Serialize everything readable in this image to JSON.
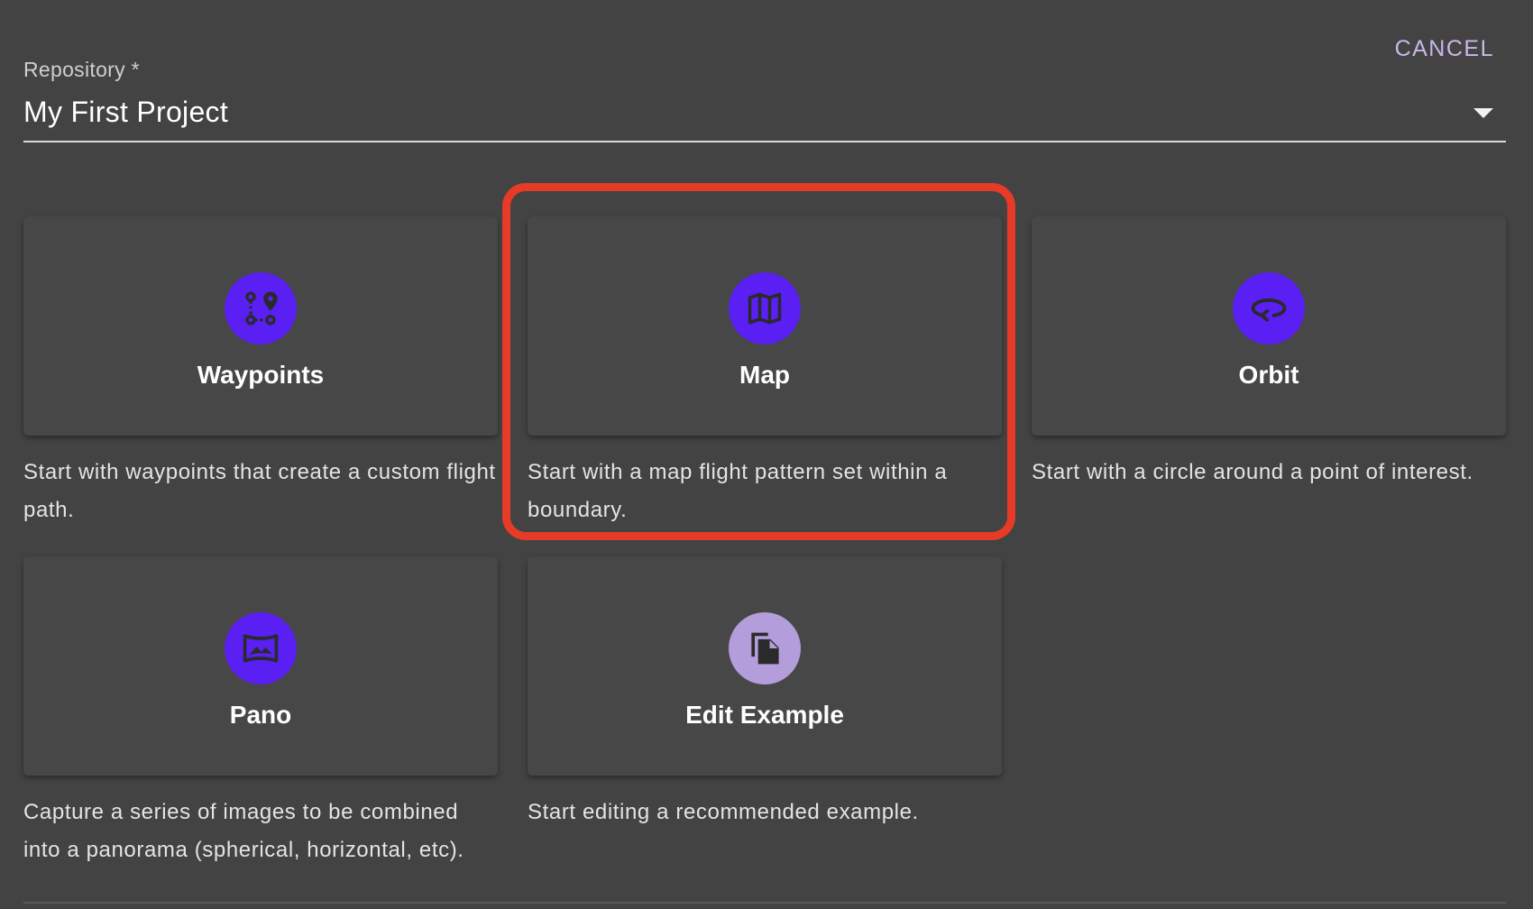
{
  "header": {
    "cancel_label": "CANCEL"
  },
  "repository": {
    "label": "Repository *",
    "value": "My First Project"
  },
  "options": [
    {
      "title": "Waypoints",
      "description": "Start with waypoints that create a custom flight path.",
      "icon": "waypoints-icon",
      "icon_color": "#5a1ff2"
    },
    {
      "title": "Map",
      "description": "Start with a map flight pattern set within a boundary.",
      "icon": "map-icon",
      "icon_color": "#5a1ff2"
    },
    {
      "title": "Orbit",
      "description": "Start with a circle around a point of interest.",
      "icon": "orbit-icon",
      "icon_color": "#5a1ff2"
    },
    {
      "title": "Pano",
      "description": "Capture a series of images to be combined into a panorama (spherical, horizontal, etc).",
      "icon": "panorama-icon",
      "icon_color": "#5a1ff2"
    },
    {
      "title": "Edit Example",
      "description": "Start editing a recommended example.",
      "icon": "copy-file-icon",
      "icon_color": "#b39ddb"
    }
  ],
  "colors": {
    "background": "#434343",
    "card": "#474747",
    "accent": "#5a1ff2",
    "highlight": "#e53b27",
    "cancel_text": "#c9b6ec"
  }
}
